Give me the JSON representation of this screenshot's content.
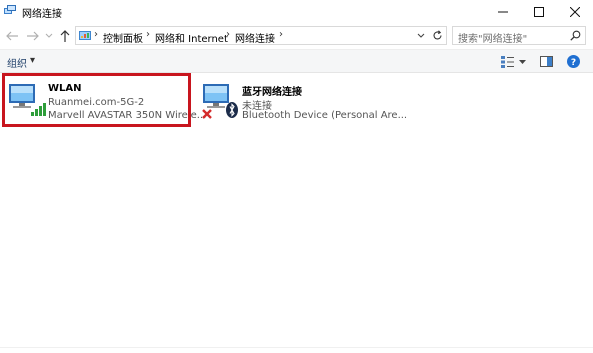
{
  "window": {
    "title": "网络连接",
    "minimize_icon": "minimize-icon",
    "maximize_icon": "maximize-icon",
    "close_icon": "close-icon"
  },
  "nav": {
    "breadcrumbs": [
      "控制面板",
      "网络和 Internet",
      "网络连接"
    ],
    "search_placeholder": "搜索\"网络连接\""
  },
  "toolbar": {
    "organize_label": "组织",
    "organize_arrow": "▾"
  },
  "connections": [
    {
      "name": "WLAN",
      "line1": "Ruanmei.com-5G-2",
      "line2": "Marvell AVASTAR 350N Wirele...",
      "icon": "wifi-monitor-icon",
      "highlighted": true
    },
    {
      "name": "蓝牙网络连接",
      "line1": "未连接",
      "line2": "Bluetooth Device (Personal Are...",
      "icon": "bluetooth-monitor-icon",
      "status_icon": "disconnected-x-icon"
    }
  ],
  "colors": {
    "highlight_border": "#c8151e",
    "toolbar_bg": "#f5f6f7",
    "link_blue": "#1a3b66"
  }
}
